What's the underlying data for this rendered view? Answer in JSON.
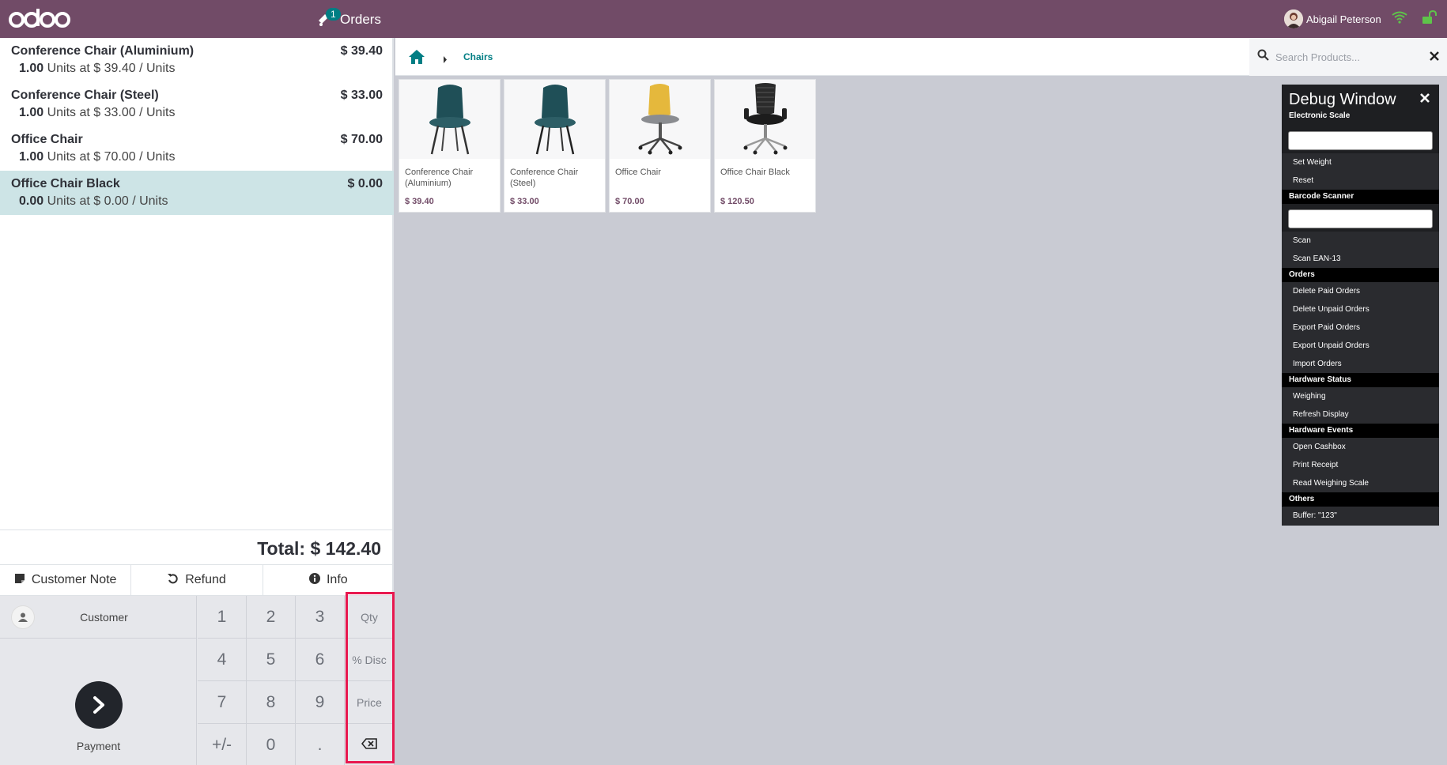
{
  "header": {
    "orders_count": "1",
    "orders_label": "Orders",
    "user_name": "Abigail Peterson"
  },
  "order": {
    "lines": [
      {
        "name": "Conference Chair (Aluminium)",
        "price": "$ 39.40",
        "qty": "1.00",
        "unit_info": "Units at $ 39.40 / Units"
      },
      {
        "name": "Conference Chair (Steel)",
        "price": "$ 33.00",
        "qty": "1.00",
        "unit_info": "Units at $ 33.00 / Units"
      },
      {
        "name": "Office Chair",
        "price": "$ 70.00",
        "qty": "1.00",
        "unit_info": "Units at $ 70.00 / Units"
      },
      {
        "name": "Office Chair Black",
        "price": "$ 0.00",
        "qty": "0.00",
        "unit_info": "Units at $ 0.00 / Units"
      }
    ],
    "total": "Total: $ 142.40"
  },
  "controls": {
    "customer_note": "Customer Note",
    "refund": "Refund",
    "info": "Info"
  },
  "actionpad": {
    "customer": "Customer",
    "payment": "Payment"
  },
  "numpad": {
    "keys": [
      "1",
      "2",
      "3",
      "Qty",
      "4",
      "5",
      "6",
      "% Disc",
      "7",
      "8",
      "9",
      "Price",
      "+/-",
      "0",
      "."
    ]
  },
  "breadcrumb": {
    "category": "Chairs"
  },
  "search": {
    "placeholder": "Search Products..."
  },
  "products": [
    {
      "name": "Conference Chair (Aluminium)",
      "price": "$ 39.40"
    },
    {
      "name": "Conference Chair (Steel)",
      "price": "$ 33.00"
    },
    {
      "name": "Office Chair",
      "price": "$ 70.00"
    },
    {
      "name": "Office Chair Black",
      "price": "$ 120.50"
    }
  ],
  "debug": {
    "title": "Debug Window",
    "electronic_scale": "Electronic Scale",
    "set_weight": "Set Weight",
    "reset": "Reset",
    "barcode_scanner": "Barcode Scanner",
    "scan": "Scan",
    "scan_ean13": "Scan EAN-13",
    "orders": "Orders",
    "delete_paid": "Delete Paid Orders",
    "delete_unpaid": "Delete Unpaid Orders",
    "export_paid": "Export Paid Orders",
    "export_unpaid": "Export Unpaid Orders",
    "import_orders": "Import Orders",
    "hardware_status": "Hardware Status",
    "weighing": "Weighing",
    "refresh_display": "Refresh Display",
    "hardware_events": "Hardware Events",
    "open_cashbox": "Open Cashbox",
    "print_receipt": "Print Receipt",
    "read_weighing_scale": "Read Weighing Scale",
    "others": "Others",
    "buffer": "Buffer: \"123\""
  },
  "colors": {
    "header_bg": "#714b67",
    "accent_teal": "#017e84",
    "selected_line": "#cde4e6",
    "highlight_border": "#e8184f",
    "wifi_green": "#5ec44a"
  },
  "icons": [
    "odoo-logo",
    "ticket-icon",
    "user-avatar",
    "wifi-icon",
    "unlock-icon",
    "home-icon",
    "chevron-right-icon",
    "search-icon",
    "close-icon",
    "note-icon",
    "undo-icon",
    "info-circle-icon",
    "user-icon",
    "chevron-right-circle-icon",
    "backspace-icon"
  ]
}
